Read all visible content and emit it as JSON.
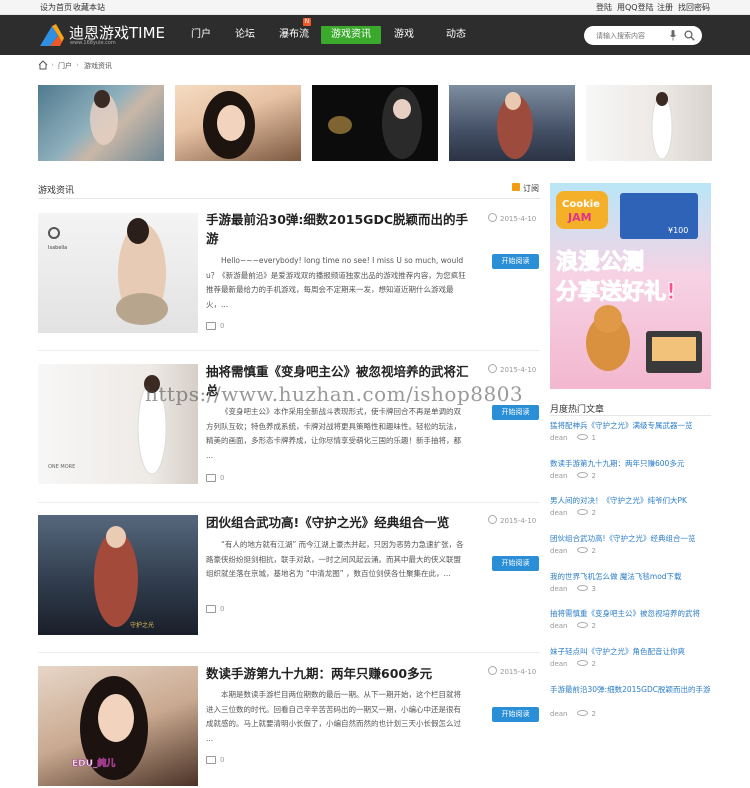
{
  "topbar": {
    "left": [
      "设为首页",
      "收藏本站"
    ],
    "right": [
      "登陆",
      "用QQ登陆",
      "注册",
      "找回密码"
    ]
  },
  "brand": {
    "name": "迪恩游戏TIME",
    "url": "www.168yule.com"
  },
  "nav": {
    "items": [
      "门户",
      "论坛",
      "瀑布流",
      "游戏资讯",
      "游戏",
      "动态"
    ],
    "active_index": 3,
    "badge": "N",
    "accent_color": "#3aa92c"
  },
  "search": {
    "placeholder": "请输入搜索内容"
  },
  "breadcrumb": [
    "门户",
    "游戏资讯"
  ],
  "section": {
    "title": "游戏资讯",
    "rss_label": "订阅"
  },
  "articles": [
    {
      "title": "手游最前沿30弹:细数2015GDC脱颖而出的手游",
      "date": "2015-4-10",
      "button": "开始阅读",
      "excerpt": "Hello~~~everybody! long time no see! I miss U so much, would u？《新游最前沿》是爱游戏双的播报频道独家出品的游戏推荐内容，为您疯狂推荐最新最给力的手机游戏，每周会不定期来一发，想知道近期什么游戏最火，...",
      "comments": "0",
      "image_caption": "Isabella"
    },
    {
      "title": "抽将需慎重《变身吧主公》被忽视培养的武将汇总",
      "date": "2015-4-10",
      "button": "开始阅读",
      "excerpt": "《变身吧主公》本作采用全新战斗表现形式，使卡牌回合不再是单调的双方列队互砍；特色养成系统，卡牌对战将更具策略性和趣味性。轻松的玩法，精美的画面，多形态卡牌养成，让你尽情享受萌化三国的乐趣！新手抽将，都 ...",
      "comments": "0",
      "image_caption": "ONE MORE"
    },
    {
      "title": "团伙组合武功高!《守护之光》经典组合一览",
      "date": "2015-4-10",
      "button": "开始阅读",
      "excerpt": "“有人的地方就有江湖” 而今江湖上豪杰并起，只因为恶势力急速扩张，各路豪侠纷纷挺剑相抗，联手对敌，一时之间风起云涌。而其中最大的侠义联盟组织就坐落在京城，基地名为 “中清龙图” ，数百位剑侠各仕聚集在此，...",
      "comments": "0",
      "image_caption": "守护之光"
    },
    {
      "title": "数读手游第九十九期：两年只赚600多元",
      "date": "2015-4-10",
      "button": "开始阅读",
      "excerpt": "本期是数读手游栏目两位期数的最后一期。从下一期开始，这个栏目就将进入三位数的时代。回看自己辛辛苦苦码出的一期又一期，小编心中还是很有成就感的。马上就要清明小长假了，小编自然而然的也计划三天小长假怎么过 ...",
      "comments": "0",
      "image_caption": "EDU_純儿"
    }
  ],
  "ad": {
    "line1": "Cookie",
    "line2": "JAM",
    "headline1": "浪漫公测",
    "headline2": "分享送好礼!",
    "card_value": "¥100"
  },
  "sidebar": {
    "title": "月度热门文章",
    "items": [
      {
        "title": "猛将配神兵《守护之光》满级专属武器一览",
        "author": "dean",
        "views": "1"
      },
      {
        "title": "数读手游第九十九期：两年只赚600多元",
        "author": "dean",
        "views": "2"
      },
      {
        "title": "男人间的对决！《守护之光》纯爷们大PK",
        "author": "dean",
        "views": "2"
      },
      {
        "title": "团伙组合武功高!《守护之光》经典组合一览",
        "author": "dean",
        "views": "2"
      },
      {
        "title": "我的世界飞机怎么做 魔法飞毯mod下载",
        "author": "dean",
        "views": "3"
      },
      {
        "title": "抽将需慎重《变身吧主公》被忽视培养的武将",
        "author": "dean",
        "views": "2"
      },
      {
        "title": "妹子轻点叫《守护之光》角色配音让你爽",
        "author": "dean",
        "views": "2"
      },
      {
        "title": "手游最前沿30弹:细数2015GDC脱颖而出的手游",
        "author": "dean",
        "views": "2"
      }
    ]
  },
  "watermark": "https://www.huzhan.com/ishop8803"
}
